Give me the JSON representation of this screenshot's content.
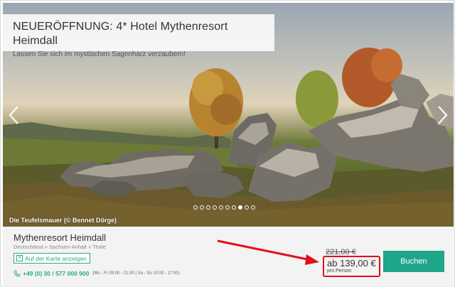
{
  "promo": {
    "title": "NEUERÖFFNUNG: 4* Hotel Mythenresort Heimdall",
    "subtitle": "Lassen Sie sich im mystischen Sagenharz verzaubern!"
  },
  "hero": {
    "caption": "Die Teufelsmauer (© Bennet Dörge)",
    "slides_total": 10,
    "active_slide": 8
  },
  "hotel": {
    "name": "Mythenresort Heimdall",
    "location": "Deutschland » Sachsen-Anhalt » Thale",
    "map_button": "Auf der Karte anzeigen",
    "phone": "+49 (0) 30 / 577 000 900",
    "hours": "(Mo - Fr 09:00 - 21:00 | Sa - So 10:00 - 17:00)"
  },
  "pricing": {
    "old_price": "221,00 €",
    "price": "ab 139,00 €",
    "per_label": "pro Person",
    "book_label": "Buchen"
  },
  "colors": {
    "accent": "#1fa589",
    "highlight": "#e0101b"
  },
  "icons": {
    "map": "map-icon",
    "phone": "phone-icon",
    "prev": "chevron-left-icon",
    "next": "chevron-right-icon"
  }
}
